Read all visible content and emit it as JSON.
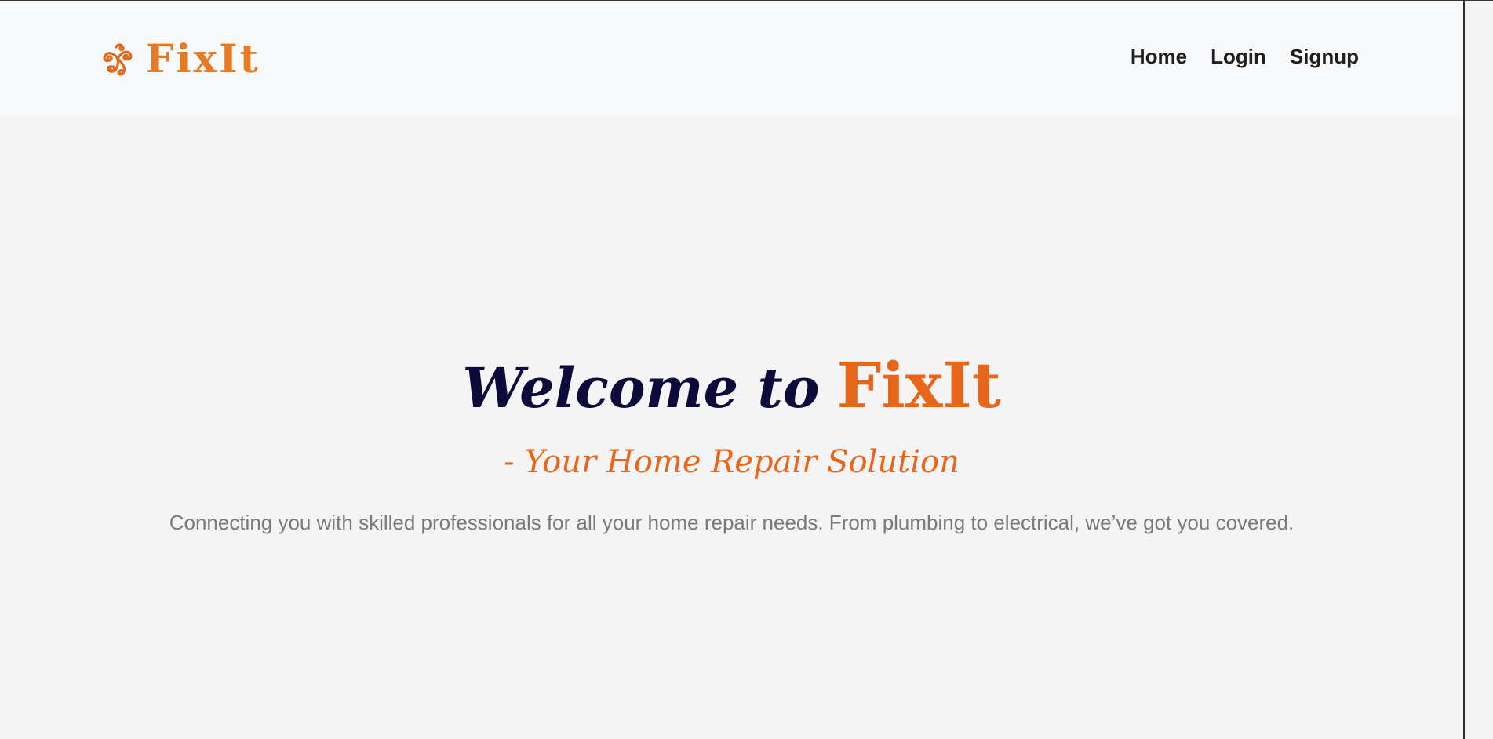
{
  "header": {
    "brand": {
      "name": "FixIt",
      "icon": "swirl-logo-icon",
      "color": "#e57a22"
    },
    "nav": [
      {
        "label": "Home"
      },
      {
        "label": "Login"
      },
      {
        "label": "Signup"
      }
    ]
  },
  "hero": {
    "title_prefix": "Welcome to",
    "title_brand": "FixIt",
    "subtitle": "- Your Home Repair Solution",
    "description": "Connecting you with skilled professionals for all your home repair needs. From plumbing to electrical, we’ve got you covered."
  },
  "colors": {
    "accent": "#e8661a",
    "heading": "#0d0b3a",
    "body_text": "#7a7a7a",
    "background": "#f4f4f4",
    "nav_background": "#f7f8fa"
  }
}
